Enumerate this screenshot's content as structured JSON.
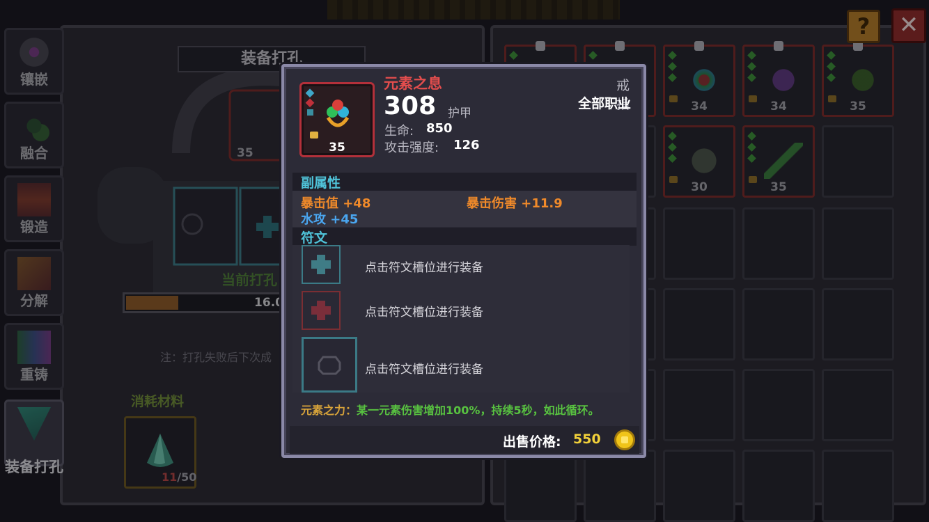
{
  "header": {
    "help_glyph": "?",
    "close_glyph": "✕"
  },
  "sidebar": {
    "tabs": [
      {
        "label": "镶嵌",
        "icon": "socket-icon"
      },
      {
        "label": "融合",
        "icon": "fusion-icon"
      },
      {
        "label": "锻造",
        "icon": "forge-icon"
      },
      {
        "label": "分解",
        "icon": "decompose-icon"
      },
      {
        "label": "重铸",
        "icon": "recast-icon"
      },
      {
        "label": "装备打孔",
        "icon": "drill-icon",
        "active": true
      }
    ]
  },
  "left_panel": {
    "title": "装备打孔",
    "current_rate_label": "当前打孔",
    "progress_text": "16.0",
    "progress_fill": 0.32,
    "note": "注：打孔失败后下次成",
    "item_level": "35",
    "material_label": "消耗材料",
    "material_count_current": "11",
    "material_count_total": "/50"
  },
  "inventory": {
    "slots": [
      {
        "level": "",
        "pinned": true
      },
      {
        "level": "",
        "pinned": true
      },
      {
        "level": "34",
        "pinned": true
      },
      {
        "level": "34",
        "pinned": true
      },
      {
        "level": "35",
        "pinned": true
      },
      {
        "level": "30",
        "pinned": false
      },
      {
        "level": "35",
        "pinned": false
      }
    ]
  },
  "tooltip": {
    "item_name": "元素之息",
    "item_level": "35",
    "main_value": "308",
    "main_value_unit": "护甲",
    "item_type": "戒指",
    "item_class": "全部职业",
    "stats": [
      {
        "label": "生命:",
        "value": "850"
      },
      {
        "label": "攻击强度:",
        "value": "126"
      }
    ],
    "sub_section_title": "副属性",
    "sub_stats": [
      {
        "label": "暴击值",
        "value": "+48",
        "color": "#f08a2a"
      },
      {
        "label": "暴击伤害",
        "value": "+11.9",
        "color": "#f08a2a"
      },
      {
        "label": "水攻",
        "value": "+45",
        "color": "#4aa6f0"
      }
    ],
    "rune_section_title": "符文",
    "rune_slots": [
      {
        "text": "点击符文槽位进行装备"
      },
      {
        "text": "点击符文槽位进行装备"
      },
      {
        "text": "点击符文槽位进行装备"
      }
    ],
    "effect_name": "元素之力：",
    "effect_desc": "某一元素伤害增加100%，持续5秒，如此循环。",
    "price_label": "出售价格:",
    "price_value": "550"
  }
}
